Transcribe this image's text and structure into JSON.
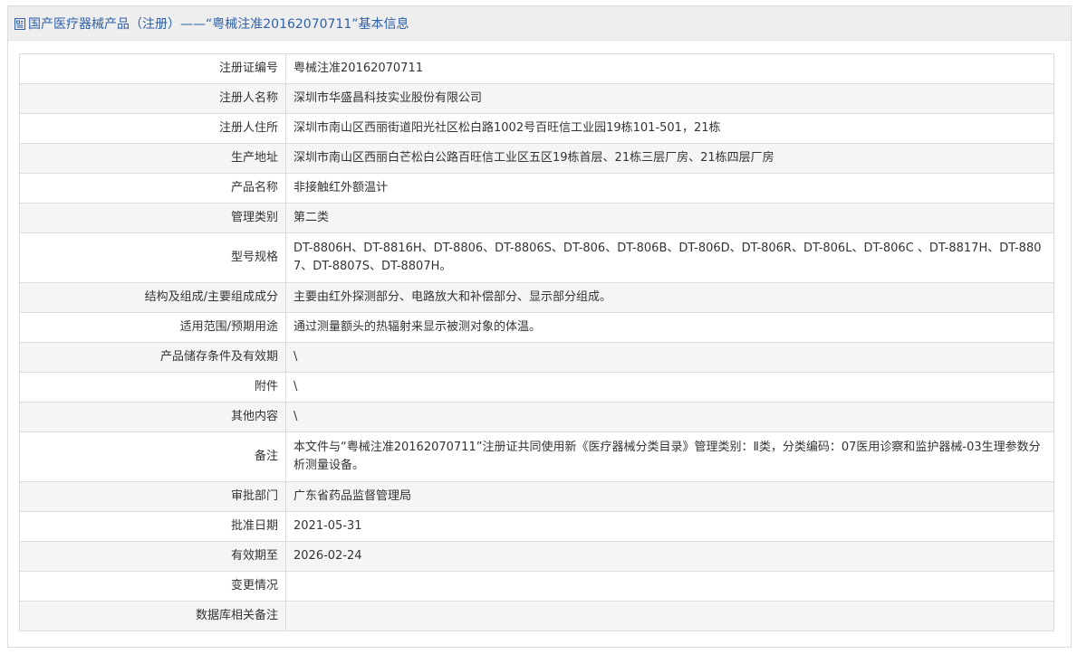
{
  "header": {
    "title": "国产医疗器械产品（注册）——“粤械注准20162070711”基本信息"
  },
  "rows": [
    {
      "label": "注册证编号",
      "value": "粤械注准20162070711"
    },
    {
      "label": "注册人名称",
      "value": "深圳市华盛昌科技实业股份有限公司"
    },
    {
      "label": "注册人住所",
      "value": "深圳市南山区西丽街道阳光社区松白路1002号百旺信工业园19栋101-501，21栋"
    },
    {
      "label": "生产地址",
      "value": "深圳市南山区西丽白芒松白公路百旺信工业区五区19栋首层、21栋三层厂房、21栋四层厂房"
    },
    {
      "label": "产品名称",
      "value": "非接触红外额温计"
    },
    {
      "label": "管理类别",
      "value": "第二类"
    },
    {
      "label": "型号规格",
      "value": "DT-8806H、DT-8816H、DT-8806、DT-8806S、DT-806、DT-806B、DT-806D、DT-806R、DT-806L、DT-806C 、DT-8817H、DT-8807、DT-8807S、DT-8807H。"
    },
    {
      "label": "结构及组成/主要组成成分",
      "value": "主要由红外探测部分、电路放大和补偿部分、显示部分组成。"
    },
    {
      "label": "适用范围/预期用途",
      "value": "通过测量额头的热辐射来显示被测对象的体温。"
    },
    {
      "label": "产品储存条件及有效期",
      "value": "\\"
    },
    {
      "label": "附件",
      "value": "\\"
    },
    {
      "label": "其他内容",
      "value": "\\"
    },
    {
      "label": "备注",
      "value": "本文件与“粤械注准20162070711”注册证共同使用新《医疗器械分类目录》管理类别：Ⅱ类，分类编码：07医用诊察和监护器械-03生理参数分析测量设备。"
    },
    {
      "label": "审批部门",
      "value": "广东省药品监督管理局"
    },
    {
      "label": "批准日期",
      "value": "2021-05-31"
    },
    {
      "label": "有效期至",
      "value": "2026-02-24"
    },
    {
      "label": "变更情况",
      "value": ""
    },
    {
      "label": "数据库相关备注",
      "value": ""
    }
  ]
}
